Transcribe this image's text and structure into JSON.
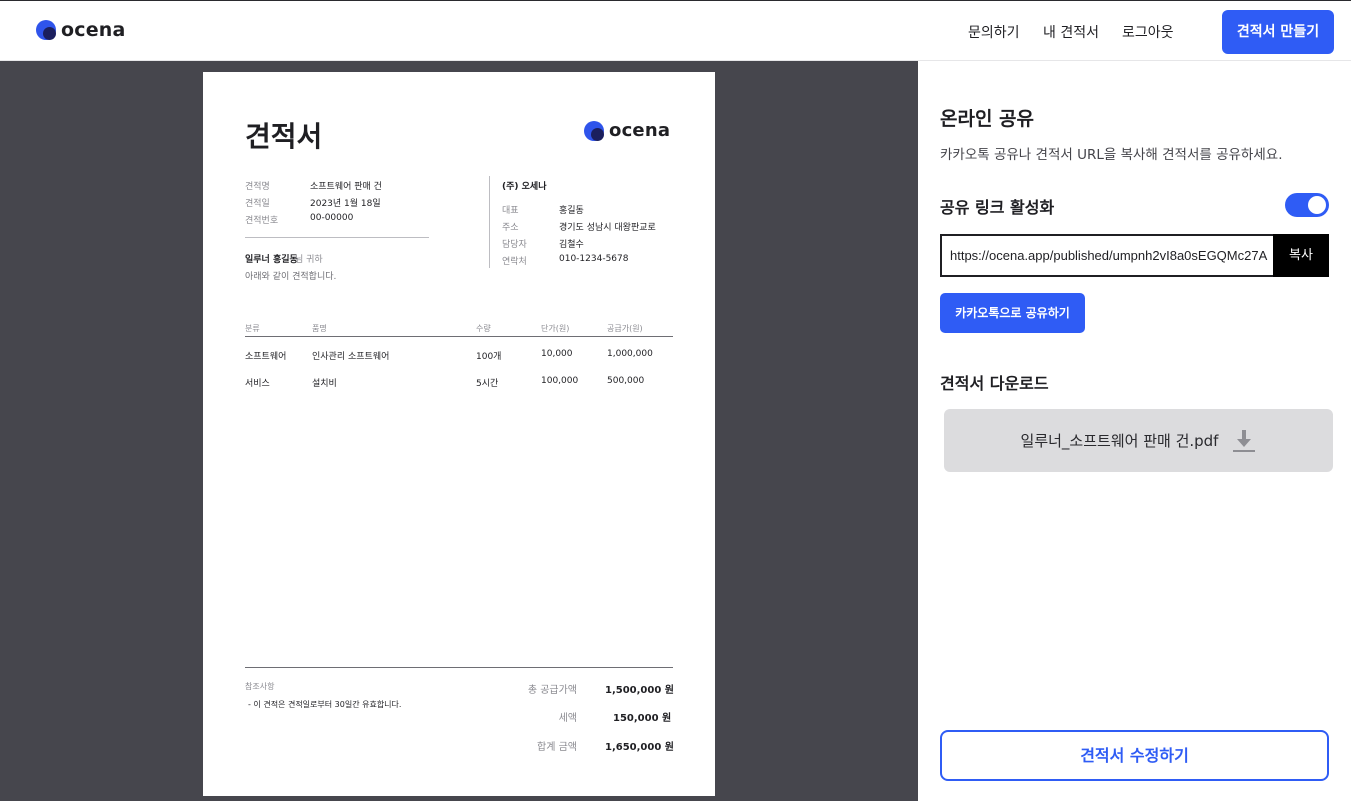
{
  "header": {
    "brand": "ocena",
    "nav": [
      "문의하기",
      "내 견적서",
      "로그아웃"
    ],
    "create_button": "견적서 만들기"
  },
  "colors": {
    "accent": "#2f5cf5",
    "preview_bg": "#46464d",
    "download_bg": "#dcdcde"
  },
  "document": {
    "title": "견적서",
    "brand": "ocena",
    "meta": [
      {
        "label": "견적명",
        "value": "소프트웨어 판매 건"
      },
      {
        "label": "견적일",
        "value": "2023년 1월 18일"
      },
      {
        "label": "견적번호",
        "value": "00-00000"
      }
    ],
    "recipient_name": "일루너 홍길동",
    "recipient_suffix": "님 귀하",
    "recipient_note": "아래와 같이 견적합니다.",
    "supplier": {
      "name": "(주) 오세나",
      "rows": [
        {
          "label": "대표",
          "value": "홍길동"
        },
        {
          "label": "주소",
          "value": "경기도 성남시 대왕판교로"
        },
        {
          "label": "담당자",
          "value": "김철수"
        },
        {
          "label": "연락처",
          "value": "010-1234-5678"
        }
      ]
    },
    "table_headers": [
      "분류",
      "품명",
      "수량",
      "단가(원)",
      "공급가(원)"
    ],
    "table_rows": [
      [
        "소프트웨어",
        "인사관리 소프트웨어",
        "100개",
        "10,000",
        "1,000,000"
      ],
      [
        "서비스",
        "설치비",
        "5시간",
        "100,000",
        "500,000"
      ]
    ],
    "notes_label": "참조사항",
    "notes": "- 이 견적은 견적일로부터 30일간 유효합니다.",
    "summary": [
      {
        "label": "총 공급가액",
        "value": "1,500,000 원"
      },
      {
        "label": "세액",
        "value": "150,000 원"
      },
      {
        "label": "합계 금액",
        "value": "1,650,000 원"
      }
    ]
  },
  "side": {
    "title": "온라인 공유",
    "description": "카카오톡 공유나 견적서 URL을 복사해 견적서를 공유하세요.",
    "share_link_label": "공유 링크 활성화",
    "share_link_enabled": true,
    "url": "https://ocena.app/published/umpnh2vI8a0sEGQMc27A",
    "copy_button": "복사",
    "kakao_button": "카카오톡으로 공유하기",
    "download_label": "견적서 다운로드",
    "download_file": "일루너_소프트웨어 판매 건.pdf",
    "edit_button": "견적서 수정하기"
  }
}
